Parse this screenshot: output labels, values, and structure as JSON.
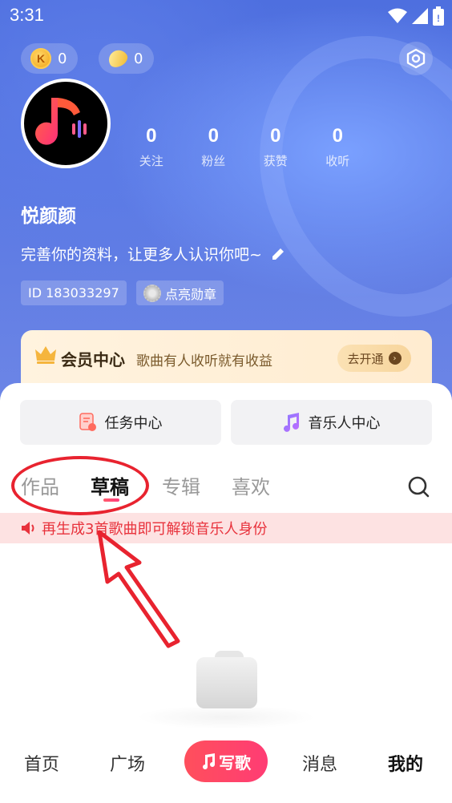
{
  "status_bar": {
    "time": "3:31",
    "icons": [
      "wifi-icon",
      "signal-icon",
      "battery-icon"
    ]
  },
  "currency": {
    "k_coin": {
      "icon": "k-coin-icon",
      "value": "0",
      "symbol": "K"
    },
    "beans": {
      "icon": "bean-icon",
      "value": "0"
    }
  },
  "profile": {
    "username": "悦颜颜",
    "bio": "完善你的资料，让更多人认识你吧~",
    "id_label": "ID 183033297",
    "medal_label": "点亮勋章",
    "stats": [
      {
        "value": "0",
        "label": "关注"
      },
      {
        "value": "0",
        "label": "粉丝"
      },
      {
        "value": "0",
        "label": "获赞"
      },
      {
        "value": "0",
        "label": "收听"
      }
    ]
  },
  "vip": {
    "title": "会员中心",
    "subtitle": "歌曲有人收听就有收益",
    "button": "去开通"
  },
  "quick_actions": [
    {
      "label": "任务中心",
      "icon": "task-icon"
    },
    {
      "label": "音乐人中心",
      "icon": "music-note-icon"
    }
  ],
  "tabs": [
    {
      "label": "作品",
      "active": false
    },
    {
      "label": "草稿",
      "active": true
    },
    {
      "label": "专辑",
      "active": false
    },
    {
      "label": "喜欢",
      "active": false
    }
  ],
  "notice": "再生成3首歌曲即可解锁音乐人身份",
  "bottom_nav": [
    {
      "label": "首页",
      "active": false
    },
    {
      "label": "广场",
      "active": false
    },
    {
      "label": "写歌",
      "active": false,
      "center": true
    },
    {
      "label": "消息",
      "active": false
    },
    {
      "label": "我的",
      "active": true
    }
  ],
  "colors": {
    "accent": "#ff3d6a",
    "notice_text": "#e8323c",
    "notice_bg": "#fde2e2",
    "annotation": "#e8232f"
  }
}
